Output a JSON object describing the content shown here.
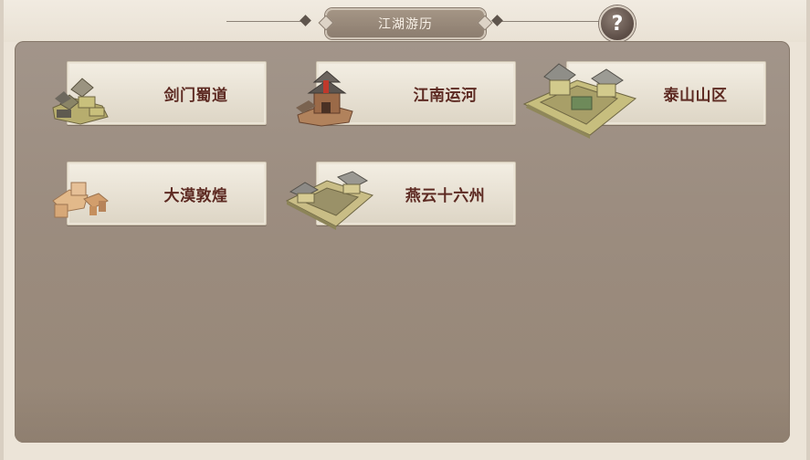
{
  "header": {
    "title": "江湖游历",
    "help_label": "?"
  },
  "regions": [
    {
      "label": "剑门蜀道",
      "icon": "mountain-village-icon"
    },
    {
      "label": "江南运河",
      "icon": "red-pavilion-icon"
    },
    {
      "label": "泰山山区",
      "icon": "mountain-fortress-icon"
    },
    {
      "label": "大漠敦煌",
      "icon": "desert-ruins-icon"
    },
    {
      "label": "燕云十六州",
      "icon": "walled-courtyard-icon"
    }
  ],
  "colors": {
    "panel": "#9c8d80",
    "card_text": "#5d2a22",
    "plaque": "#9a8b7c"
  }
}
